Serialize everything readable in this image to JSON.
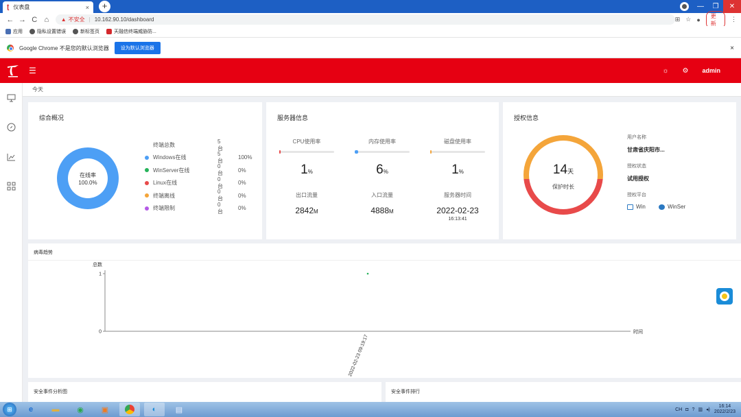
{
  "browser": {
    "tab_title": "仪表盘",
    "tab_close": "×",
    "new_tab": "+",
    "win_minimize": "—",
    "win_maximize": "❐",
    "win_close": "✕",
    "back": "←",
    "forward": "→",
    "reload": "C",
    "home": "⌂",
    "security_warning": "▲",
    "insecure_label": "不安全",
    "separator": "|",
    "url": "10.162.90.10/dashboard",
    "update_label": "更新",
    "bookmarks": [
      {
        "label": "应用"
      },
      {
        "label": "隐私设置错误"
      },
      {
        "label": "新标签页"
      },
      {
        "label": "天融信终端威胁防..."
      }
    ],
    "infobar_text": "Google Chrome 不是您的默认浏览器",
    "infobar_button": "设为默认浏览器",
    "infobar_close": "×"
  },
  "header": {
    "menu_icon": "☰",
    "bulb_icon": "☼",
    "settings_icon": "⚙",
    "user": "admin"
  },
  "sidebar": {
    "items": [
      {
        "icon": "monitor-icon",
        "glyph": "▭"
      },
      {
        "icon": "compass-icon",
        "glyph": "◎"
      },
      {
        "icon": "chart-icon",
        "glyph": "⫽"
      },
      {
        "icon": "apps-icon",
        "glyph": "▦"
      }
    ]
  },
  "breadcrumb": "今天",
  "overview": {
    "title": "综合概况",
    "donut_label": "在线率",
    "donut_value": "100.0%",
    "online_rate": 1.0,
    "total_label": "终端总数",
    "total_value": "5台",
    "rows": [
      {
        "label": "Windows在线",
        "count": "5台",
        "pct": "100%",
        "color": "#4d9ff5"
      },
      {
        "label": "WinServer在线",
        "count": "0台",
        "pct": "0%",
        "color": "#25b35a"
      },
      {
        "label": "Linux在线",
        "count": "0台",
        "pct": "0%",
        "color": "#e84a4a"
      },
      {
        "label": "终端离线",
        "count": "0台",
        "pct": "0%",
        "color": "#f4a53a"
      },
      {
        "label": "终端限制",
        "count": "0台",
        "pct": "0%",
        "color": "#b45ae6"
      }
    ]
  },
  "server": {
    "title": "服务器信息",
    "metrics": [
      {
        "label": "CPU使用率",
        "value": "1",
        "unit": "%",
        "fill": 0.01,
        "color": "#e84a4a"
      },
      {
        "label": "内存使用率",
        "value": "6",
        "unit": "%",
        "fill": 0.06,
        "color": "#4d9ff5"
      },
      {
        "label": "磁盘使用率",
        "value": "1",
        "unit": "%",
        "fill": 0.01,
        "color": "#f4a53a"
      }
    ],
    "out_label": "出口流量",
    "out_value": "2842",
    "out_unit": "M",
    "in_label": "入口流量",
    "in_value": "4888",
    "in_unit": "M",
    "time_label": "服务器时间",
    "date": "2022-02-23",
    "time": "16:13:41"
  },
  "license": {
    "title": "授权信息",
    "days": "14",
    "days_unit": "天",
    "sub": "保护时长",
    "user_label": "用户名称",
    "user_value": "甘肃省庆阳市...",
    "status_label": "授权状态",
    "status_value": "试用授权",
    "platform_label": "授权平台",
    "platforms": [
      "Win",
      "WinSer"
    ],
    "colors": {
      "top": "#f4a53a",
      "bottom": "#e84a4a"
    }
  },
  "virus": {
    "title": "病毒趋势",
    "chart_data": {
      "type": "scatter",
      "title": "",
      "ylabel": "总数",
      "xlabel": "时间",
      "yticks": [
        "1",
        "0"
      ],
      "ylim": [
        0,
        1
      ],
      "x": [
        "2022-02-23 09:19:17"
      ],
      "series": [
        {
          "values": [
            1
          ]
        }
      ]
    }
  },
  "bottom": {
    "left_title": "安全事件分析图",
    "right_title": "安全事件排行"
  },
  "taskbar": {
    "lang": "CH",
    "time": "16:14",
    "date": "2022/2/23"
  }
}
